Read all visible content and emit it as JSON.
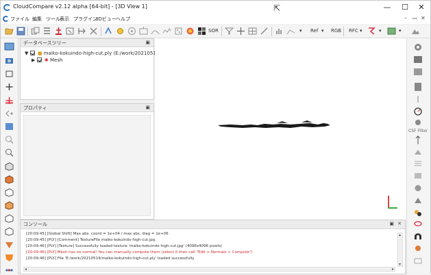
{
  "window": {
    "title": "CloudCompare v2.12 alpha [64-bit] - [3D View 1]",
    "controls": {
      "minimize": "—",
      "maximize": "☐",
      "close": "✕"
    }
  },
  "menu": {
    "items": [
      "ファイル",
      "編集",
      "ツール",
      "表示",
      "プラグイン",
      "3Dビュー",
      "ヘルプ"
    ],
    "mdi_controls": [
      "–",
      "ꟷ",
      "✕"
    ]
  },
  "toolbar": {
    "labels": [
      "SOR",
      "Ref",
      "RGB",
      "RFC"
    ]
  },
  "db_tree": {
    "title": "データベースツリー",
    "root_label": "maiko-kokuindo-high-cut.ply (E:/work/20210519...",
    "child_label": "Mesh"
  },
  "properties": {
    "title": "プロパティ"
  },
  "console": {
    "title": "コンソール",
    "lines": [
      {
        "text": "[20:09:45] [Global Shift] Max abs. coord = 1e+04 / max abs. diag = 1e+06",
        "level": "info"
      },
      {
        "text": "[20:09:45] [PLY] [Comment] TextureFile maiko-kokuindo-high-cut.jpg",
        "level": "info"
      },
      {
        "text": "[20:09:46] [PLY] [Texture] Successfully loaded texture 'maiko-kokuindo-high-cut.jpg' (4096x4096 pixels)",
        "level": "info"
      },
      {
        "text": "[20:09:46] [PLY] Mesh has no normal! You can manually compute them (select it then call \"Edit > Normals > Compute\")",
        "level": "error"
      },
      {
        "text": "[20:09:46] [PLY] File 'E:/work/20210519/maiko-kokuindo-high-cut.ply' loaded successfully",
        "level": "info"
      }
    ]
  },
  "right_toolbar": {
    "labels": [
      "CSF Filter"
    ]
  },
  "colors": {
    "accent": "#2f6fb7",
    "error_text": "#cc2b2b",
    "axis_x": "#3faa3f",
    "axis_y": "#e04040"
  }
}
